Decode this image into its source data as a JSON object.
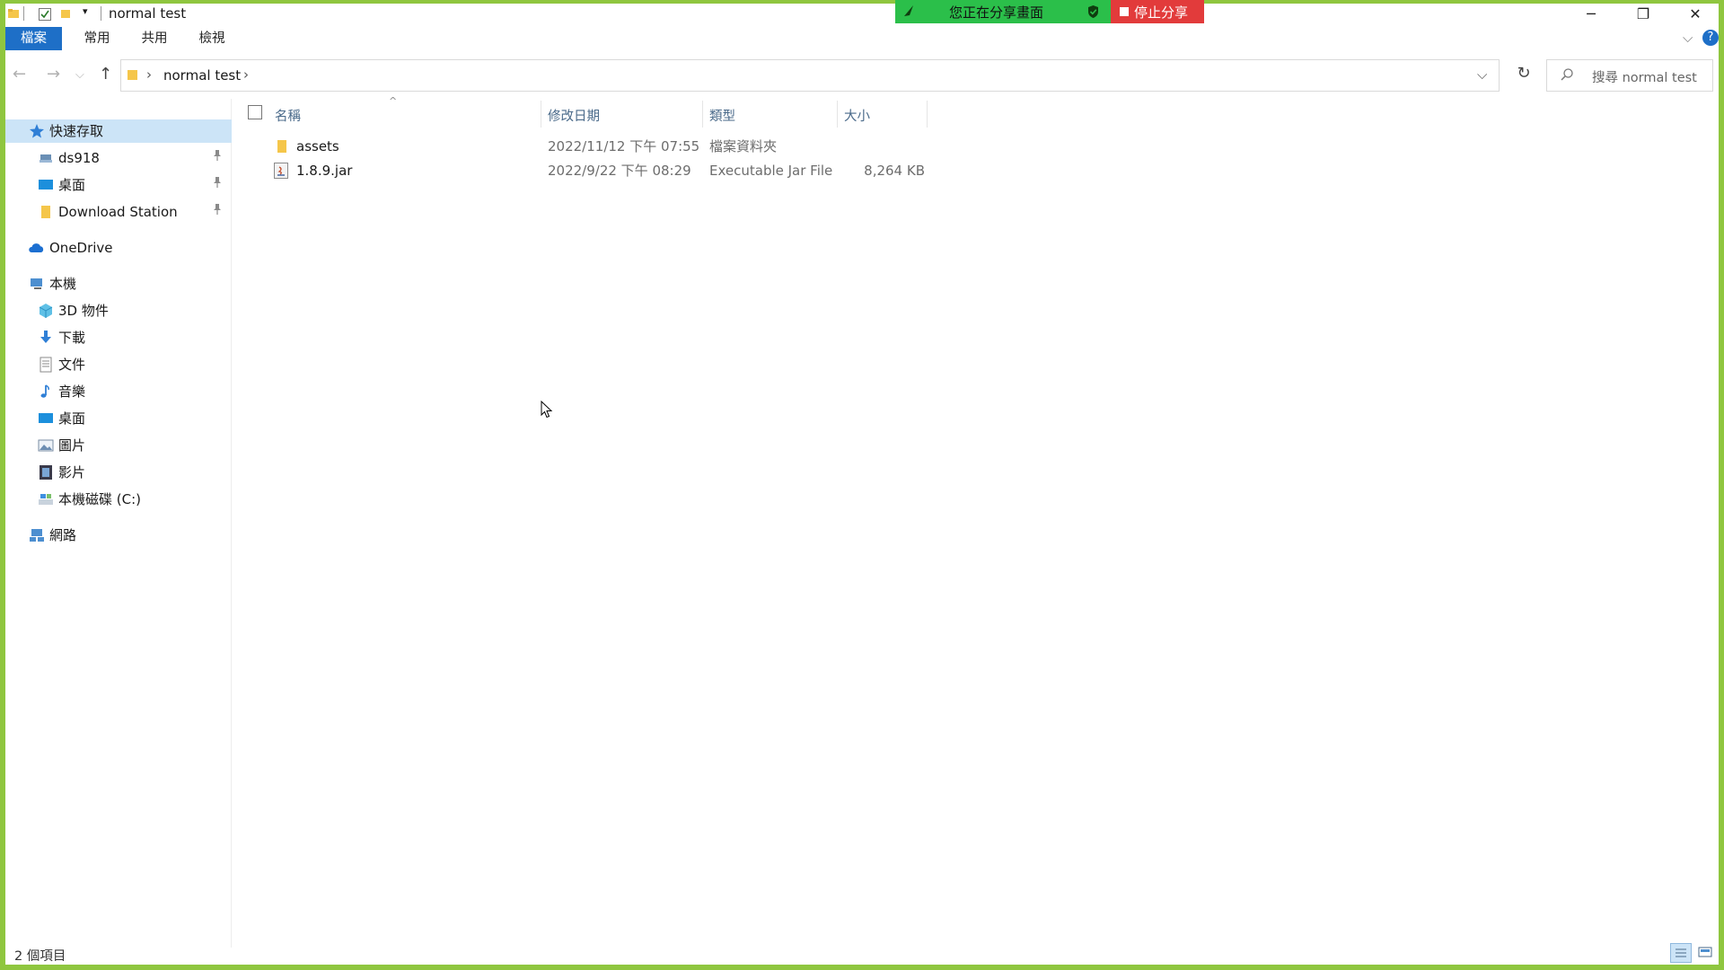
{
  "window": {
    "title": "normal test",
    "minimize_glyph": "─",
    "restore_glyph": "❐",
    "close_glyph": "✕"
  },
  "share_banner": {
    "status_text": "您正在分享畫面",
    "stop_label": "停止分享",
    "green": "#2bbf4a",
    "red": "#e23b3b"
  },
  "ribbon": {
    "tabs": [
      {
        "label": "檔案",
        "active": true
      },
      {
        "label": "常用"
      },
      {
        "label": "共用"
      },
      {
        "label": "檢視"
      }
    ],
    "accent": "#1e6fc7",
    "help_glyph": "?",
    "collapse_glyph": "⌵"
  },
  "addressbar": {
    "path": [
      "normal test"
    ],
    "separator": "›",
    "dropdown_glyph": "⌵",
    "refresh_glyph": "↻"
  },
  "nav_buttons": {
    "back": "←",
    "forward": "→",
    "recent": "⌵",
    "up": "↑"
  },
  "search": {
    "placeholder": "搜尋 normal test",
    "icon": "search-icon"
  },
  "sidebar": {
    "items": [
      {
        "label": "快速存取",
        "icon": "star-icon",
        "selected": true
      },
      {
        "label": "ds918",
        "icon": "network-drive-icon",
        "pinned": true
      },
      {
        "label": "桌面",
        "icon": "desktop-icon",
        "pinned": true
      },
      {
        "label": "Download Station",
        "icon": "folder-icon",
        "pinned": true
      },
      {
        "label": "OneDrive",
        "icon": "cloud-icon"
      },
      {
        "label": "本機",
        "icon": "computer-icon"
      },
      {
        "label": "3D 物件",
        "icon": "cube-icon"
      },
      {
        "label": "下載",
        "icon": "download-icon"
      },
      {
        "label": "文件",
        "icon": "document-icon"
      },
      {
        "label": "音樂",
        "icon": "music-icon"
      },
      {
        "label": "桌面",
        "icon": "desktop-icon"
      },
      {
        "label": "圖片",
        "icon": "picture-icon"
      },
      {
        "label": "影片",
        "icon": "video-icon"
      },
      {
        "label": "本機磁碟 (C:)",
        "icon": "disk-icon"
      },
      {
        "label": "網路",
        "icon": "network-icon"
      }
    ],
    "pin_glyph": "📌"
  },
  "filelist": {
    "columns": {
      "name": "名稱",
      "modified": "修改日期",
      "type": "類型",
      "size": "大小",
      "sort_glyph": "^"
    },
    "rows": [
      {
        "name": "assets",
        "modified": "2022/11/12 下午 07:55",
        "type": "檔案資料夾",
        "size": "",
        "icon": "folder-icon"
      },
      {
        "name": "1.8.9.jar",
        "modified": "2022/9/22 下午 08:29",
        "type": "Executable Jar File",
        "size": "8,264 KB",
        "icon": "jar-file-icon"
      }
    ]
  },
  "statusbar": {
    "count_text": "2 個項目"
  }
}
